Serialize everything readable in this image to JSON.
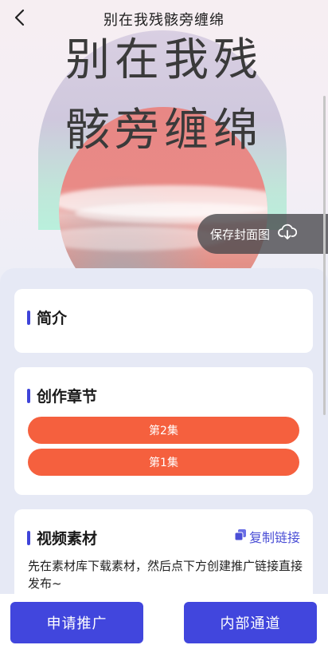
{
  "header": {
    "title": "别在我残骸旁缠绵"
  },
  "cover": {
    "line1": "别在我残",
    "line2": "骸旁缠绵",
    "save_label": "保存封面图"
  },
  "intro": {
    "title": "简介"
  },
  "chapters": {
    "title": "创作章节",
    "items": [
      {
        "label": "第2集"
      },
      {
        "label": "第1集"
      }
    ]
  },
  "video": {
    "title": "视频素材",
    "copy_label": "复制链接",
    "description": "先在素材库下载素材，然后点下方创建推广链接直接发布~"
  },
  "bottom": {
    "apply_label": "申请推广",
    "internal_label": "内部通道"
  },
  "colors": {
    "accent": "#4146dd",
    "chapter": "#f5603e"
  }
}
